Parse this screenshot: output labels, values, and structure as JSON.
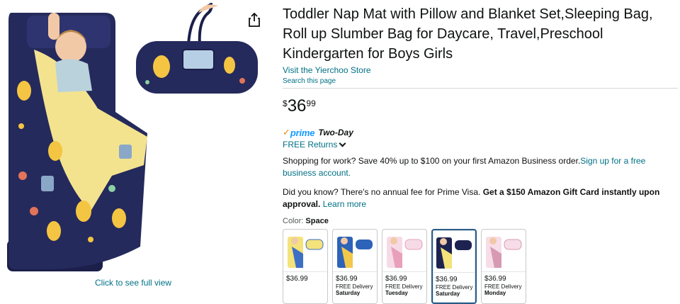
{
  "gallery": {
    "full_view_label": "Click to see full view"
  },
  "product": {
    "title": "Toddler Nap Mat with Pillow and Blanket Set,Sleeping Bag, Roll up Slumber Bag for Daycare, Travel,Preschool Kindergarten for Boys Girls",
    "store_link": "Visit the Yierchoo Store",
    "search_page": "Search this page"
  },
  "price": {
    "symbol": "$",
    "whole": "36",
    "fraction": "99"
  },
  "prime": {
    "check": "✓",
    "word": "prime",
    "type": "Two-Day"
  },
  "returns": {
    "label": "FREE Returns"
  },
  "business": {
    "text": "Shopping for work? Save 40% up to $100 on your first Amazon Business order.",
    "link": "Sign up for a free business account."
  },
  "visa": {
    "text": "Did you know? There's no annual fee for Prime Visa.",
    "bold": "Get a $150 Amazon Gift Card instantly upon approval.",
    "link": "Learn more"
  },
  "color": {
    "label": "Color:",
    "selected": "Space"
  },
  "swatches": [
    {
      "price": "$36.99",
      "delivery": "",
      "day": "",
      "mat": "#f4e27a",
      "accent": "#3d6fc4"
    },
    {
      "price": "$36.99",
      "delivery": "FREE Delivery",
      "day": "Saturday",
      "mat": "#2d63b8",
      "accent": "#f2c84b"
    },
    {
      "price": "$36.99",
      "delivery": "FREE Delivery",
      "day": "Tuesday",
      "mat": "#f6dbe6",
      "accent": "#e8a0bb"
    },
    {
      "price": "$36.99",
      "delivery": "FREE Delivery",
      "day": "Saturday",
      "mat": "#1d2350",
      "accent": "#f4e27a"
    },
    {
      "price": "$36.99",
      "delivery": "FREE Delivery",
      "day": "Monday",
      "mat": "#f7dde8",
      "accent": "#d79ab3"
    }
  ]
}
